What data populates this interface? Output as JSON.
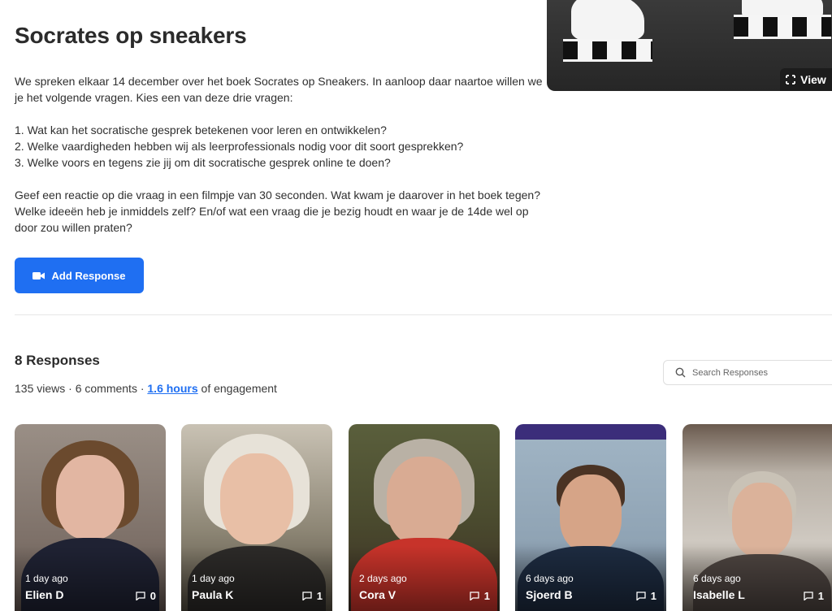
{
  "cover": {
    "view_label": "View"
  },
  "prompt": {
    "title": "Socrates op sneakers",
    "intro": "We spreken elkaar 14 december over het boek Socrates op Sneakers. In aanloop daar naartoe willen we je het volgende vragen. Kies een van deze drie vragen:",
    "questions": [
      "1. Wat kan het socratische gesprek betekenen voor leren en ontwikkelen?",
      "2. Welke vaardigheden hebben wij als leerprofessionals nodig voor dit soort gesprekken?",
      "3. Welke voors en tegens zie jij om dit socratische gesprek online te doen?"
    ],
    "outro": "Geef een reactie op die vraag in een filmpje van 30 seconden. Wat kwam je daarover in het boek tegen? Welke ideeën heb je inmiddels zelf? En/of wat een vraag die je bezig houdt en waar je de 14de wel op door zou willen praten?",
    "add_response_label": "Add Response"
  },
  "responses": {
    "heading": "8 Responses",
    "stats_prefix": "135 views · 6 comments · ",
    "engagement_link": "1.6 hours",
    "stats_suffix": " of engagement",
    "search_placeholder": "Search Responses",
    "cards": [
      {
        "ago": "1 day ago",
        "name": "Elien D",
        "comments": "0"
      },
      {
        "ago": "1 day ago",
        "name": "Paula K",
        "comments": "1"
      },
      {
        "ago": "2 days ago",
        "name": "Cora V",
        "comments": "1"
      },
      {
        "ago": "6 days ago",
        "name": "Sjoerd B",
        "comments": "1"
      },
      {
        "ago": "6 days ago",
        "name": "Isabelle L",
        "comments": "1"
      }
    ]
  },
  "colors": {
    "accent": "#1f6ff2",
    "text": "#2b2b2b"
  },
  "icons": {
    "expand": "expand-icon",
    "video": "video-camera-icon",
    "search": "search-icon",
    "comment": "comment-icon"
  }
}
